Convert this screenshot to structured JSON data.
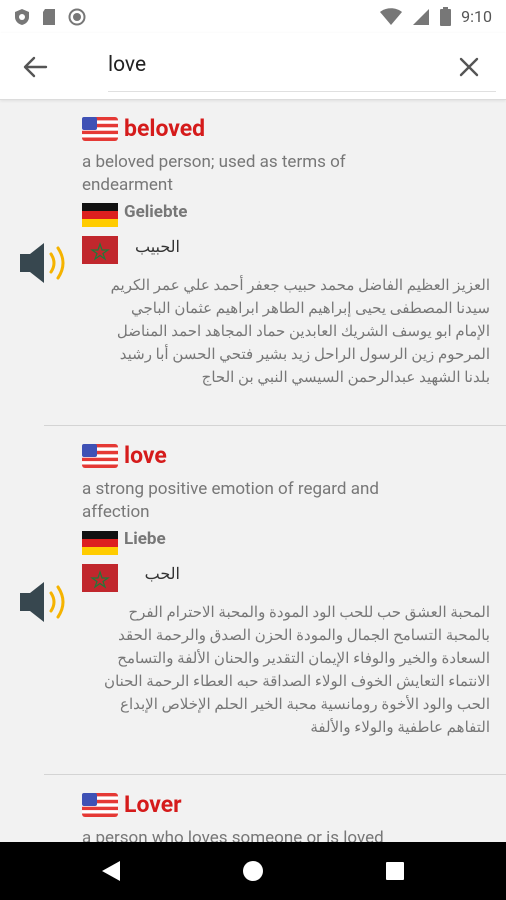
{
  "status_bar": {
    "time": "9:10",
    "icons": [
      "shield-icon",
      "sd-card-icon",
      "circle-icon",
      "wifi-icon",
      "signal-icon",
      "battery-icon"
    ]
  },
  "search": {
    "query": "love",
    "icons": [
      "arrow-back-icon",
      "close-icon"
    ]
  },
  "entries": [
    {
      "term": "beloved",
      "definition": "a beloved person; used as terms of endearment",
      "german": "Geliebte",
      "arabic": "الحبيب",
      "arabic_synonyms": "العزيز العظيم الفاضل محمد حبيب جعفر أحمد علي عمر الكريم سيدنا المصطفى يحيى إبراهيم الطاهر ابراهيم عثمان الباجي الإمام ابو يوسف الشريك العابدين حماد المجاهد احمد المناضل المرحوم زين الرسول الراحل زيد بشير فتحي الحسن أبا رشيد بلدنا الشهيد عبدالرحمن السيسي النبي بن الحاج"
    },
    {
      "term": "love",
      "definition": "a strong positive emotion of regard and affection",
      "german": "Liebe",
      "arabic": "الحب",
      "arabic_synonyms": "المحبة العشق حب للحب الود المودة والمحبة الاحترام الفرح بالمحبة التسامح الجمال والمودة الحزن الصدق والرحمة الحقد السعادة والخير والوفاء الإيمان التقدير والحنان الألفة والتسامح الانتماء التعايش الخوف الولاء الصداقة حبه العطاء الرحمة الحنان الحب والود الأخوة رومانسية محبة الخير الحلم الإخلاص الإبداع التفاهم عاطفية والولاء والألفة"
    },
    {
      "term": "Lover",
      "definition": "a person who loves someone or is loved"
    }
  ],
  "colors": {
    "term_red": "#d51b1b",
    "text_gray": "#777777",
    "background": "#f2f2f2"
  }
}
